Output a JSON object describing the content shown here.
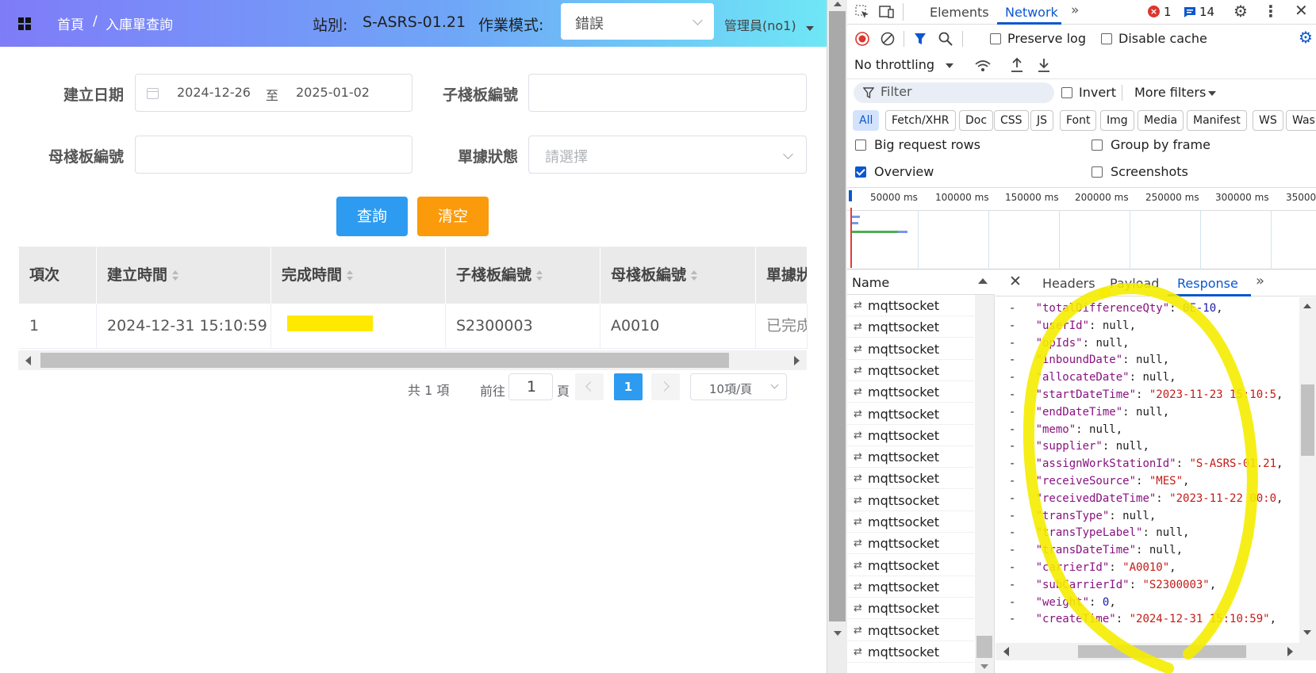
{
  "app": {
    "breadcrumb": {
      "home": "首頁",
      "separator": "/",
      "current": "入庫單查詢"
    },
    "station_label": "站別:",
    "station_value": "S-ASRS-01.21",
    "mode_label": "作業模式:",
    "mode_value": "錯誤",
    "user": "管理員(no1)",
    "form": {
      "created_date_label": "建立日期",
      "date_start": "2024-12-26",
      "date_to": "至",
      "date_end": "2025-01-02",
      "sub_carrier_label": "子棧板編號",
      "carrier_label": "母棧板編號",
      "status_label": "單據狀態",
      "status_placeholder": "請選擇",
      "search_button": "查詢",
      "clear_button": "清空"
    },
    "table": {
      "headers": [
        "項次",
        "建立時間",
        "完成時間",
        "子棧板編號",
        "母棧板編號",
        "單據狀"
      ],
      "rows": [
        {
          "index": "1",
          "created": "2024-12-31 15:10:59",
          "completed": "",
          "sub_carrier": "S2300003",
          "carrier": "A0010",
          "status": "已完成"
        }
      ]
    },
    "pagination": {
      "total": "共 1 項",
      "goto_label": "前往",
      "goto_value": "1",
      "page_unit": "頁",
      "current_page": "1",
      "page_size": "10項/頁"
    }
  },
  "devtools": {
    "tabs": [
      "Elements",
      "Network"
    ],
    "error_count": "1",
    "message_count": "14",
    "preserve_log": "Preserve log",
    "disable_cache": "Disable cache",
    "throttling": "No throttling",
    "filter_placeholder": "Filter",
    "invert": "Invert",
    "more_filters": "More filters",
    "filter_chips": [
      "All",
      "Fetch/XHR",
      "Doc",
      "CSS",
      "JS",
      "Font",
      "Img",
      "Media",
      "Manifest",
      "WS",
      "Wasm"
    ],
    "options": {
      "big_request_rows": "Big request rows",
      "group_by_frame": "Group by frame",
      "overview": "Overview",
      "screenshots": "Screenshots"
    },
    "timeline_ticks": [
      "50000 ms",
      "100000 ms",
      "150000 ms",
      "200000 ms",
      "250000 ms",
      "300000 ms",
      "35000"
    ],
    "name_header": "Name",
    "request_name": "mqttsocket",
    "detail_tabs": [
      "Headers",
      "Payload",
      "Response"
    ],
    "response_lines": [
      {
        "key": "\"totalDifferenceQty\"",
        "value": "0E-10",
        "type": "n"
      },
      {
        "key": "\"userId\"",
        "value": "null",
        "type": "p"
      },
      {
        "key": "\"opIds\"",
        "value": "null",
        "type": "p"
      },
      {
        "key": "\"inboundDate\"",
        "value": "null",
        "type": "p"
      },
      {
        "key": "\"allocateDate\"",
        "value": "null",
        "type": "p"
      },
      {
        "key": "\"startDateTime\"",
        "value": "\"2023-11-23 15:10:5",
        "type": "s"
      },
      {
        "key": "\"endDateTime\"",
        "value": "null",
        "type": "p"
      },
      {
        "key": "\"memo\"",
        "value": "null",
        "type": "p"
      },
      {
        "key": "\"supplier\"",
        "value": "null",
        "type": "p"
      },
      {
        "key": "\"assignWorkStationId\"",
        "value": "\"S-ASRS-01.21",
        "type": "s"
      },
      {
        "key": "\"receiveSource\"",
        "value": "\"MES\"",
        "type": "s"
      },
      {
        "key": "\"receivedDateTime\"",
        "value": "\"2023-11-22 00:0",
        "type": "s"
      },
      {
        "key": "\"transType\"",
        "value": "null",
        "type": "p"
      },
      {
        "key": "\"transTypeLabel\"",
        "value": "null",
        "type": "p"
      },
      {
        "key": "\"transDateTime\"",
        "value": "null",
        "type": "p"
      },
      {
        "key": "\"carrierId\"",
        "value": "\"A0010\"",
        "type": "s"
      },
      {
        "key": "\"subCarrierId\"",
        "value": "\"S2300003\"",
        "type": "s"
      },
      {
        "key": "\"weight\"",
        "value": "0",
        "type": "n"
      },
      {
        "key": "\"createTime\"",
        "value": "\"2024-12-31 15:10:59\"",
        "type": "s"
      }
    ]
  }
}
